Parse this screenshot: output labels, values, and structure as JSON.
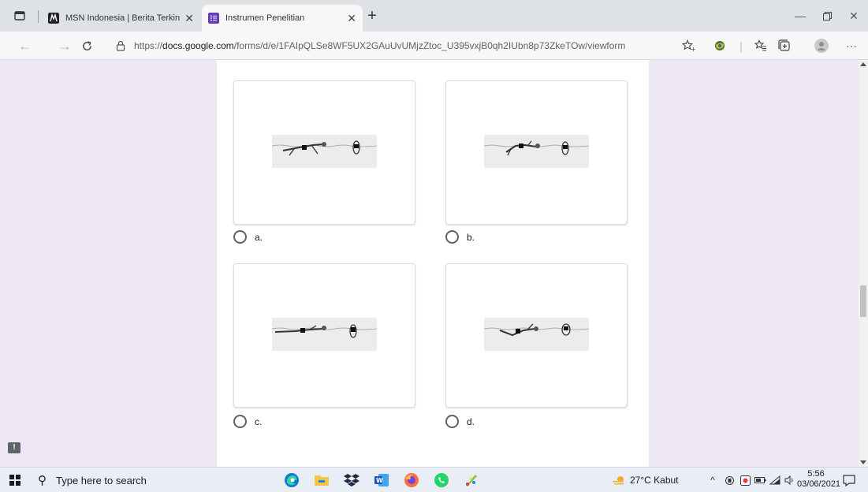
{
  "browser": {
    "tabs": [
      {
        "title": "MSN Indonesia | Berita Terkini H",
        "favicon": "msn-icon",
        "active": false
      },
      {
        "title": "Instrumen Penelitian",
        "favicon": "google-forms-icon",
        "active": true
      }
    ],
    "url_prefix": "https://",
    "url_domain": "docs.google.com",
    "url_path": "/forms/d/e/1FAIpQLSe8WF5UX2GAuUvUMjzZtoc_U395vxjB0qh2IUbn8p73ZkeTOw/viewform"
  },
  "form": {
    "options": [
      {
        "label": "a.",
        "image": "swimming-stroke-a"
      },
      {
        "label": "b.",
        "image": "swimming-stroke-b"
      },
      {
        "label": "c.",
        "image": "swimming-stroke-c"
      },
      {
        "label": "d.",
        "image": "swimming-stroke-d"
      }
    ]
  },
  "feedback": {
    "symbol": "!"
  },
  "taskbar": {
    "search_placeholder": "Type here to search",
    "weather": "27°C  Kabut",
    "time": "5:56",
    "date": "03/06/2021"
  },
  "colors": {
    "page_background": "#ede7f6",
    "forms_purple": "#673ab7"
  }
}
